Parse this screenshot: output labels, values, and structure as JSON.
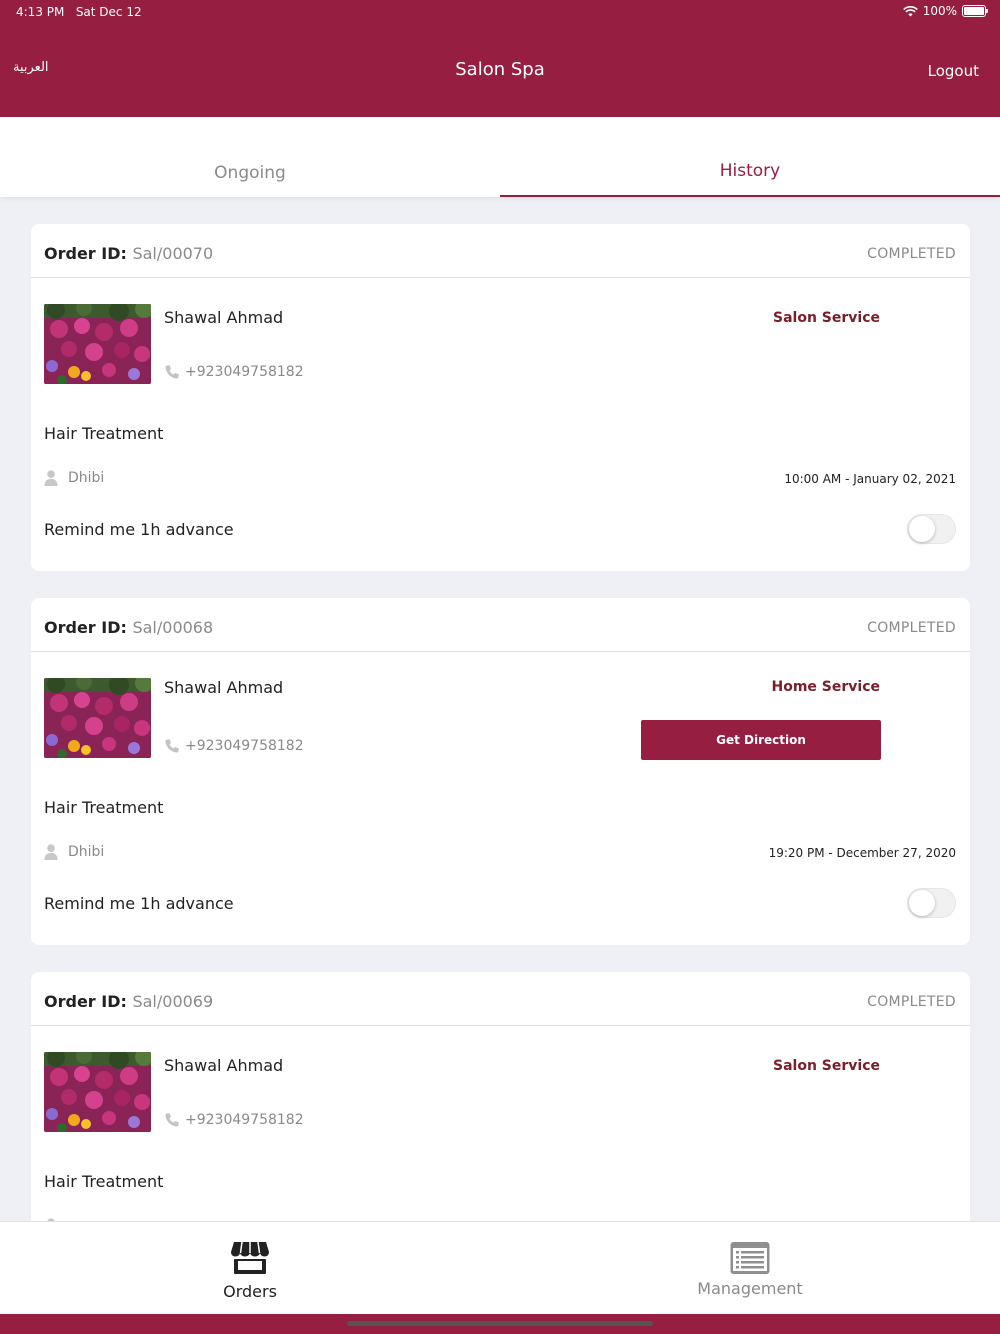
{
  "status_bar": {
    "time": "4:13 PM",
    "date": "Sat Dec 12",
    "battery": "100%"
  },
  "header": {
    "language_link": "العربية",
    "title": "Salon Spa",
    "logout": "Logout"
  },
  "tabs": [
    {
      "label": "Ongoing",
      "active": false
    },
    {
      "label": "History",
      "active": true
    }
  ],
  "labels": {
    "order_id": "Order ID:",
    "remind": "Remind me 1h advance",
    "get_direction": "Get Direction"
  },
  "orders": [
    {
      "id": "Sal/00070",
      "status": "COMPLETED",
      "customer": "Shawal Ahmad",
      "phone": "+923049758182",
      "service_type": "Salon Service",
      "service": "Hair Treatment",
      "staff": "Dhibi",
      "datetime": "10:00 AM - January 02, 2021",
      "remind": false
    },
    {
      "id": "Sal/00068",
      "status": "COMPLETED",
      "customer": "Shawal Ahmad",
      "phone": "+923049758182",
      "service_type": "Home Service",
      "service": "Hair Treatment",
      "staff": "Dhibi",
      "datetime": "19:20 PM - December 27, 2020",
      "remind": false
    },
    {
      "id": "Sal/00069",
      "status": "COMPLETED",
      "customer": "Shawal Ahmad",
      "phone": "+923049758182",
      "service_type": "Salon Service",
      "service": "Hair Treatment",
      "staff": "",
      "datetime": "",
      "remind": false
    }
  ],
  "bottom_nav": [
    {
      "label": "Orders",
      "icon": "store-icon",
      "active": true
    },
    {
      "label": "Management",
      "icon": "list-icon",
      "active": false
    }
  ],
  "colors": {
    "brand": "#961e40",
    "service_type": "#7a1e2a",
    "muted": "#8a8a8a",
    "background": "#eef0f5"
  }
}
